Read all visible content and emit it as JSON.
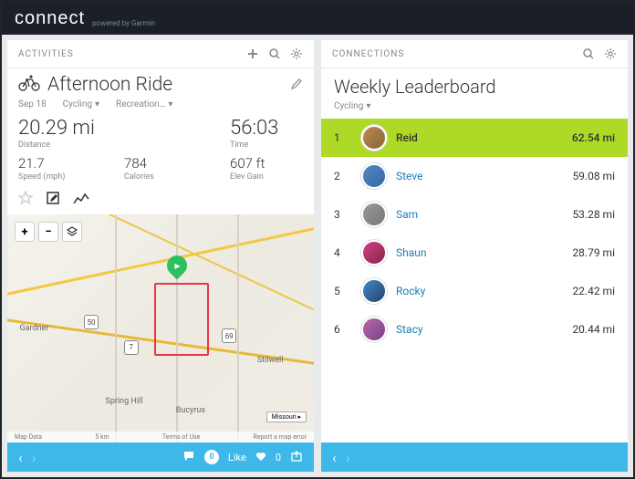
{
  "brand": {
    "logo": "connect",
    "sub": "powered by Garmin"
  },
  "activities": {
    "header": "ACTIVITIES",
    "title": "Afternoon Ride",
    "date": "Sep 18",
    "type": "Cycling",
    "category": "Recreation…",
    "distance": {
      "value": "20.29 mi",
      "label": "Distance"
    },
    "time": {
      "value": "56:03",
      "label": "Time"
    },
    "speed": {
      "value": "21.7",
      "label": "Speed (mph)"
    },
    "calories": {
      "value": "784",
      "label": "Calories"
    },
    "elev": {
      "value": "607 ft",
      "label": "Elev Gain"
    },
    "map": {
      "cities": [
        "Gardner",
        "Spring Hill",
        "Stilwell",
        "Bucyrus"
      ],
      "shields": [
        "50",
        "7",
        "69"
      ],
      "footer": {
        "data": "Map Data",
        "scale": "5 km",
        "terms": "Terms of Use",
        "report": "Report a map error"
      },
      "badge": "Missouri ▸"
    },
    "footer": {
      "comments": "0",
      "like": "Like",
      "likes": "0"
    }
  },
  "connections": {
    "header": "CONNECTIONS",
    "title": "Weekly Leaderboard",
    "filter": "Cycling",
    "rows": [
      {
        "rank": "1",
        "name": "Reid",
        "dist": "62.54 mi",
        "top": true
      },
      {
        "rank": "2",
        "name": "Steve",
        "dist": "59.08 mi"
      },
      {
        "rank": "3",
        "name": "Sam",
        "dist": "53.28 mi"
      },
      {
        "rank": "4",
        "name": "Shaun",
        "dist": "28.79 mi"
      },
      {
        "rank": "5",
        "name": "Rocky",
        "dist": "22.42 mi"
      },
      {
        "rank": "6",
        "name": "Stacy",
        "dist": "20.44 mi"
      }
    ]
  }
}
